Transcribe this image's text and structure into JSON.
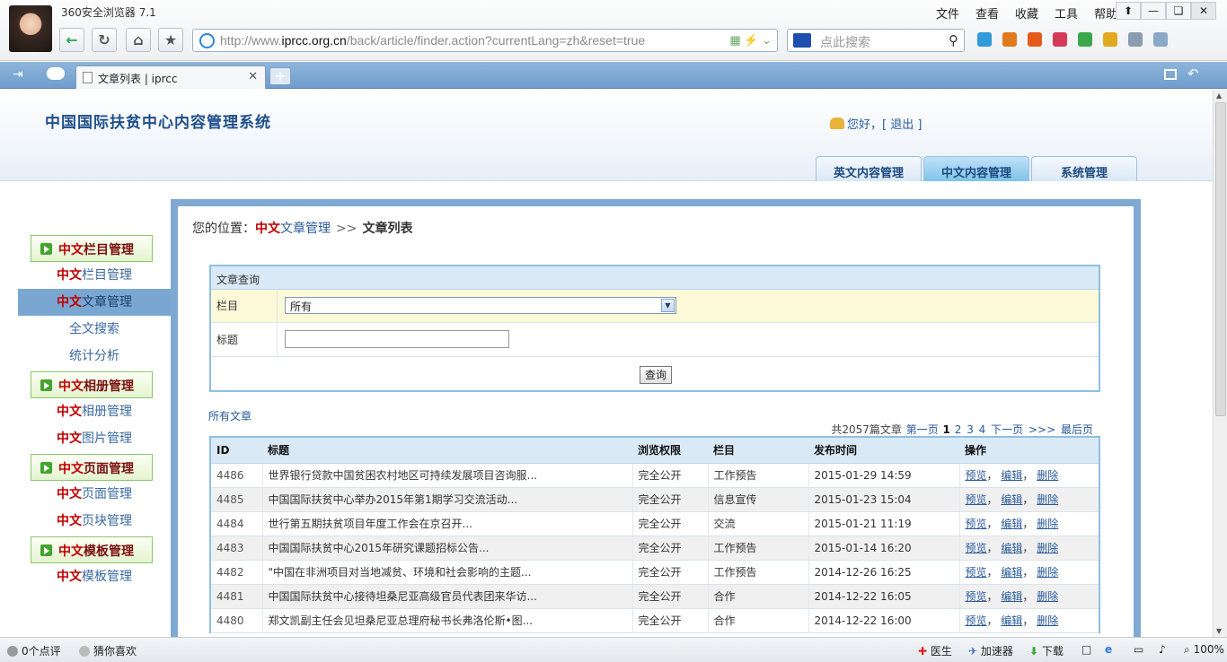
{
  "browser": {
    "app_title": "360安全浏览器 7.1",
    "url_prefix": "http://www.",
    "url_domain": "iprcc.org.cn",
    "url_rest": "/back/article/finder.action?currentLang=zh&reset=true",
    "search_placeholder": "点此搜索",
    "menus": [
      "文件",
      "查看",
      "收藏",
      "工具",
      "帮助"
    ],
    "tab_title": "文章列表 | iprcc",
    "status_left": [
      "0个点评",
      "猜你喜欢"
    ],
    "status_right": {
      "doctor": "医生",
      "accel": "加速器",
      "download": "下载",
      "zoom": "100%"
    }
  },
  "site": {
    "system_title": "中国国际扶贫中心内容管理系统",
    "user_greeting": "您好，",
    "logout": "[ 退出 ]",
    "nav_tabs": [
      {
        "label": "英文内容管理",
        "active": false
      },
      {
        "label": "中文内容管理",
        "active": true
      },
      {
        "label": "系统管理",
        "active": false
      }
    ],
    "sidebar": {
      "groups": [
        {
          "prefix": "中文",
          "label": "栏目管理"
        },
        {
          "prefix": "中文",
          "label": "相册管理"
        },
        {
          "prefix": "中文",
          "label": "页面管理"
        },
        {
          "prefix": "中文",
          "label": "模板管理"
        }
      ],
      "items": {
        "column_mgmt": {
          "prefix": "中文",
          "label": "栏目管理"
        },
        "article_mgmt": {
          "prefix": "中文",
          "label": "文章管理"
        },
        "fulltext_search": "全文搜索",
        "statistics": "统计分析",
        "album_mgmt": {
          "prefix": "中文",
          "label": "相册管理"
        },
        "image_mgmt": {
          "prefix": "中文",
          "label": "图片管理"
        },
        "page_mgmt": {
          "prefix": "中文",
          "label": "页面管理"
        },
        "block_mgmt": {
          "prefix": "中文",
          "label": "页块管理"
        },
        "template_mgmt": {
          "prefix": "中文",
          "label": "模板管理"
        }
      }
    },
    "breadcrumb": {
      "label": "您的位置：",
      "red": "中文",
      "link": "文章管理",
      "sep": ">>",
      "current": "文章列表"
    },
    "query": {
      "title": "文章查询",
      "column_label": "栏目",
      "column_value": "所有",
      "title_label": "标题",
      "title_value": "",
      "submit": "查询"
    },
    "list": {
      "all_articles": "所有文章",
      "pager": {
        "total": "共2057篇文章",
        "first": "第一页",
        "pages": [
          "1",
          "2",
          "3",
          "4"
        ],
        "next": "下一页",
        "jump": ">>>",
        "last": "最后页"
      },
      "headers": [
        "ID",
        "标题",
        "浏览权限",
        "栏目",
        "发布时间",
        "操作"
      ],
      "op_labels": {
        "preview": "预览",
        "edit": "编辑",
        "delete": "删除"
      },
      "rows": [
        {
          "id": "4486",
          "title": "世界银行贷款中国贫困农村地区可持续发展项目咨询服...",
          "perm": "完全公开",
          "column": "工作预告",
          "time": "2015-01-29 14:59"
        },
        {
          "id": "4485",
          "title": "中国国际扶贫中心举办2015年第1期学习交流活动...",
          "perm": "完全公开",
          "column": "信息宣传",
          "time": "2015-01-23 15:04"
        },
        {
          "id": "4484",
          "title": "世行第五期扶贫项目年度工作会在京召开...",
          "perm": "完全公开",
          "column": "交流",
          "time": "2015-01-21 11:19"
        },
        {
          "id": "4483",
          "title": "中国国际扶贫中心2015年研究课题招标公告...",
          "perm": "完全公开",
          "column": "工作预告",
          "time": "2015-01-14 16:20"
        },
        {
          "id": "4482",
          "title": "\"中国在非洲项目对当地减贫、环境和社会影响的主题...",
          "perm": "完全公开",
          "column": "工作预告",
          "time": "2014-12-26 16:25"
        },
        {
          "id": "4481",
          "title": "中国国际扶贫中心接待坦桑尼亚高级官员代表团来华访...",
          "perm": "完全公开",
          "column": "合作",
          "time": "2014-12-22 16:05"
        },
        {
          "id": "4480",
          "title": "郑文凯副主任会见坦桑尼亚总理府秘书长弗洛伦斯•图...",
          "perm": "完全公开",
          "column": "合作",
          "time": "2014-12-22 16:00"
        }
      ]
    }
  }
}
